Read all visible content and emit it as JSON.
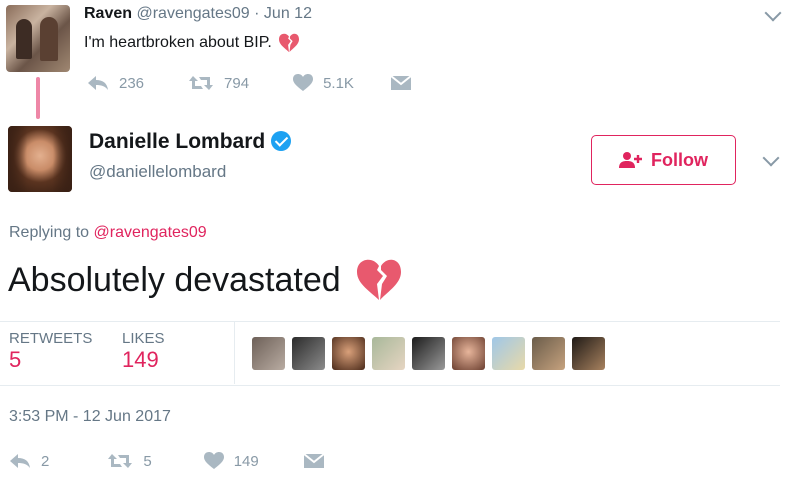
{
  "reply_tweet": {
    "name": "Raven",
    "handle": "@ravengates09",
    "separator": "·",
    "date": "Jun 12",
    "text": "I'm heartbroken about BIP.",
    "actions": {
      "replies": "236",
      "retweets": "794",
      "likes": "5.1K"
    }
  },
  "main_tweet": {
    "name": "Danielle Lombard",
    "handle": "@daniellelombard",
    "follow_label": "Follow",
    "replying_prefix": "Replying to",
    "replying_to": "@ravengates09",
    "text": "Absolutely devastated",
    "stats": {
      "retweets_label": "RETWEETS",
      "retweets_value": "5",
      "likes_label": "LIKES",
      "likes_value": "149"
    },
    "timestamp": "3:53 PM - 12 Jun 2017",
    "actions": {
      "replies": "2",
      "retweets": "5",
      "likes": "149"
    }
  },
  "colors": {
    "accent": "#e0245e",
    "verified": "#1da1f2",
    "muted": "#8899a6",
    "text": "#14171a"
  },
  "icons": [
    "reply-icon",
    "retweet-icon",
    "heart-icon",
    "dm-envelope-icon",
    "broken-heart-emoji",
    "verified-badge-icon",
    "follow-user-icon",
    "chevron-down-icon"
  ]
}
